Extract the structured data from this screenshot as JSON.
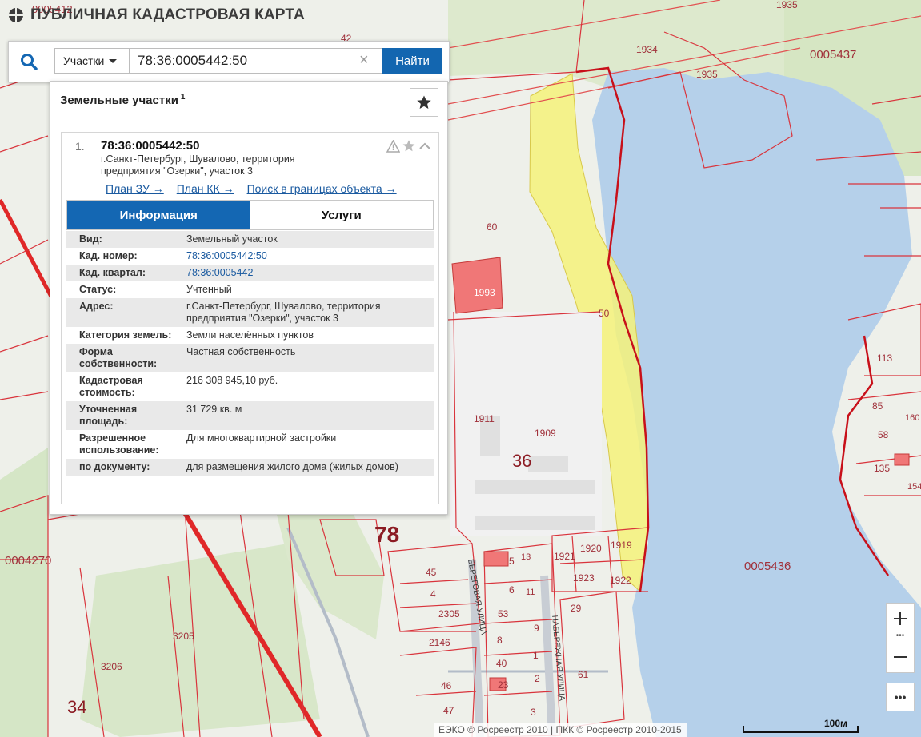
{
  "app": {
    "title": "ПУБЛИЧНАЯ КАДАСТРОВАЯ КАРТА"
  },
  "search": {
    "type_label": "Участки",
    "query": "78:36:0005442:50",
    "button": "Найти"
  },
  "panel": {
    "heading": "Земельные участки",
    "count": "1",
    "result": {
      "number": "1.",
      "id": "78:36:0005442:50",
      "address": "г.Санкт-Петербург, Шувалово, территория предприятия \"Озерки\", участок 3",
      "links": [
        "План ЗУ →",
        "План КК →",
        "Поиск в границах объекта →"
      ]
    },
    "tabs": [
      "Информация",
      "Услуги"
    ],
    "rows": [
      {
        "k": "Вид:",
        "v": "Земельный участок"
      },
      {
        "k": "Кад. номер:",
        "v": "78:36:0005442:50"
      },
      {
        "k": "Кад. квартал:",
        "v": "78:36:0005442"
      },
      {
        "k": "Статус:",
        "v": "Учтенный"
      },
      {
        "k": "Адрес:",
        "v": "г.Санкт-Петербург, Шувалово, территория предприятия \"Озерки\", участок 3"
      },
      {
        "k": "Категория земель:",
        "v": "Земли населённых пунктов"
      },
      {
        "k": "Форма собственности:",
        "v": "Частная собственность"
      },
      {
        "k": "Кадастровая стоимость:",
        "v": "216 308 945,10 руб."
      },
      {
        "k": "Уточненная площадь:",
        "v": "31 729 кв. м"
      },
      {
        "k": "Разрешенное использование:",
        "v": "Для многоквартирной застройки"
      },
      {
        "k": "по документу:",
        "v": "для размещения жилого дома (жилых домов)"
      }
    ]
  },
  "map": {
    "labels": {
      "q5437": "0005437",
      "q5436": "0005436",
      "q4270": "0004270",
      "q5412": "0005412",
      "big78": "78",
      "big36": "36",
      "big34": "34",
      "p1935": "1935",
      "p1934": "1934",
      "p1935b": "1935",
      "p42": "42",
      "p60": "60",
      "p50": "50",
      "p1993": "1993",
      "p1911": "1911",
      "p1909": "1909",
      "p1921": "1921",
      "p1920": "1920",
      "p1919": "1919",
      "p1923": "1923",
      "p1922": "1922",
      "p45": "45",
      "p5": "5",
      "p13": "13",
      "p4": "4",
      "p6": "6",
      "p11": "11",
      "p2305": "2305",
      "p53": "53",
      "p29": "29",
      "p2146": "2146",
      "p8": "8",
      "p9": "9",
      "p40": "40",
      "p1": "1",
      "p61": "61",
      "p46": "46",
      "p23": "23",
      "p2": "2",
      "p47": "47",
      "p3": "3",
      "p3205": "3205",
      "p3206": "3206",
      "p113": "113",
      "p85": "85",
      "p58": "58",
      "p135": "135",
      "p154": "154",
      "p160": "160",
      "street1": "БЕРЕГОВАЯ УЛИЦА",
      "street2": "НАБЕРЕЖНАЯ УЛИЦА"
    }
  },
  "footer": {
    "copyright": "ЕЭКО © Росреестр 2010 | ПКК © Росреестр 2010-2015",
    "scale": "100м"
  }
}
